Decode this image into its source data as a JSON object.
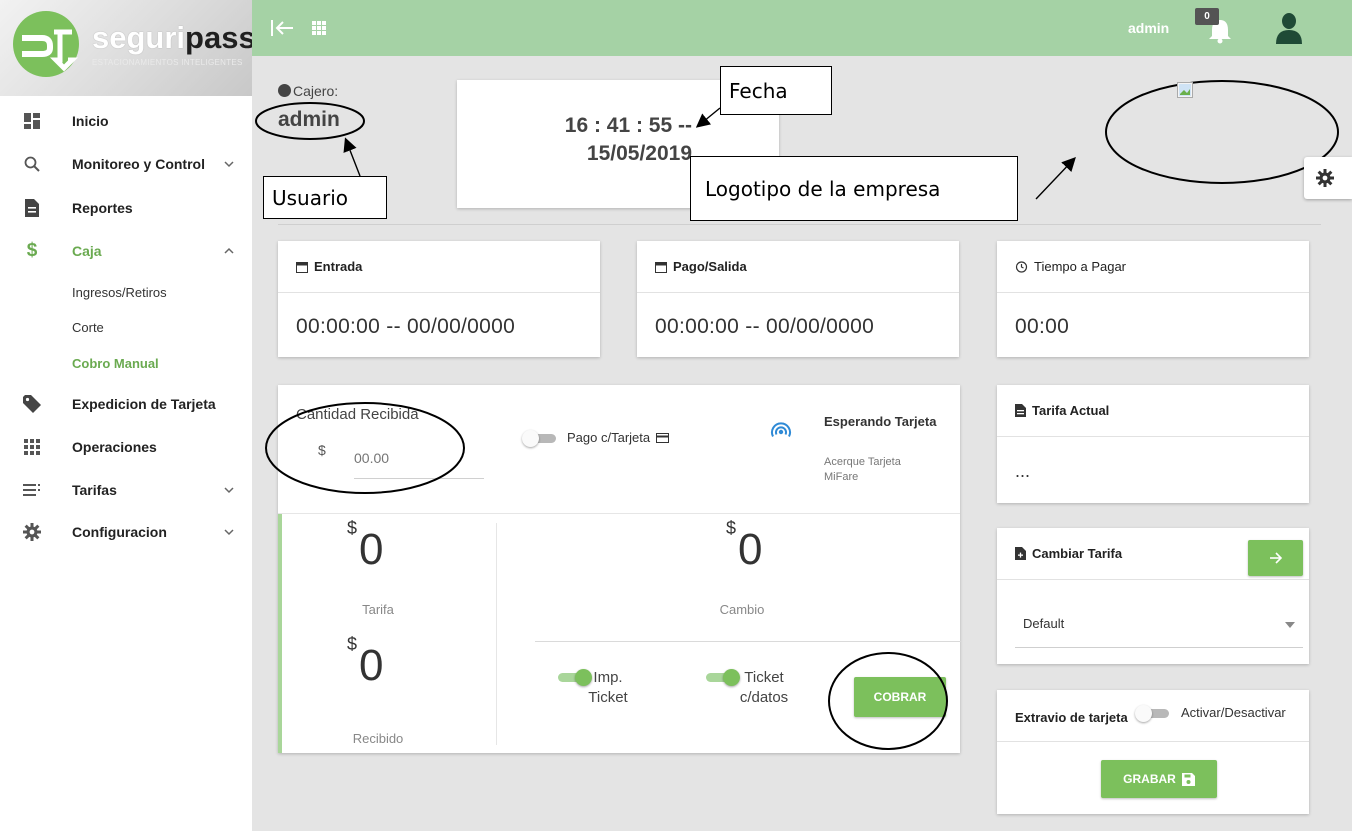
{
  "brand": {
    "name_part1": "seguri",
    "name_part2": "pass",
    "tagline": "ESTACIONAMIENTOS INTELIGENTES"
  },
  "sidebar": {
    "items": [
      {
        "label": "Inicio",
        "icon": "dashboard-icon"
      },
      {
        "label": "Monitoreo y Control",
        "icon": "search-icon"
      },
      {
        "label": "Reportes",
        "icon": "document-icon"
      },
      {
        "label": "Caja",
        "icon": "dollar-icon"
      },
      {
        "label": "Expedicion de Tarjeta",
        "icon": "tag-icon"
      },
      {
        "label": "Operaciones",
        "icon": "apps-icon"
      },
      {
        "label": "Tarifas",
        "icon": "list-icon"
      },
      {
        "label": "Configuracion",
        "icon": "gear-icon"
      }
    ],
    "caja_sub": [
      "Ingresos/Retiros",
      "Corte",
      "Cobro Manual"
    ]
  },
  "topbar": {
    "user": "admin",
    "notifications": "0"
  },
  "cashier": {
    "label": "Cajero:",
    "name": "admin"
  },
  "clock": {
    "time": "16 : 41 : 55 --",
    "date": "15/05/2019"
  },
  "annotations": {
    "fecha": "Fecha",
    "usuario": "Usuario",
    "logo": "Logotipo de la empresa"
  },
  "cards": {
    "entrada": {
      "title": "Entrada",
      "value": "00:00:00 -- 00/00/0000"
    },
    "pago_salida": {
      "title": "Pago/Salida",
      "value": "00:00:00 -- 00/00/0000"
    },
    "tiempo": {
      "title": "Tiempo a Pagar",
      "value": "00:00"
    },
    "tarifa_actual": {
      "title": "Tarifa Actual",
      "value": "..."
    },
    "cambiar_tarifa": {
      "title": "Cambiar Tarifa",
      "selected": "Default"
    },
    "extravio": {
      "title": "Extravio de tarjeta",
      "toggle_label": "Activar/Desactivar",
      "save_label": "GRABAR"
    }
  },
  "payment": {
    "received_label": "Cantidad Recibida",
    "currency": "$",
    "received_placeholder": "00.00",
    "card_toggle_label": "Pago c/Tarjeta",
    "card_status_title": "Esperando Tarjeta",
    "card_status_hint": "Acerque Tarjeta MiFare",
    "currency_symbol": "$",
    "tarifa_value": "0",
    "tarifa_label": "Tarifa",
    "cambio_value": "0",
    "cambio_label": "Cambio",
    "recibido_value": "0",
    "recibido_label": "Recibido",
    "imp_ticket_label": "Imp. Ticket",
    "ticket_datos_label": "Ticket c/datos",
    "cobrar_label": "COBRAR"
  },
  "colors": {
    "topbar": "#a5d2a5",
    "accent": "#7cc05c",
    "background": "#e4e4e4"
  }
}
